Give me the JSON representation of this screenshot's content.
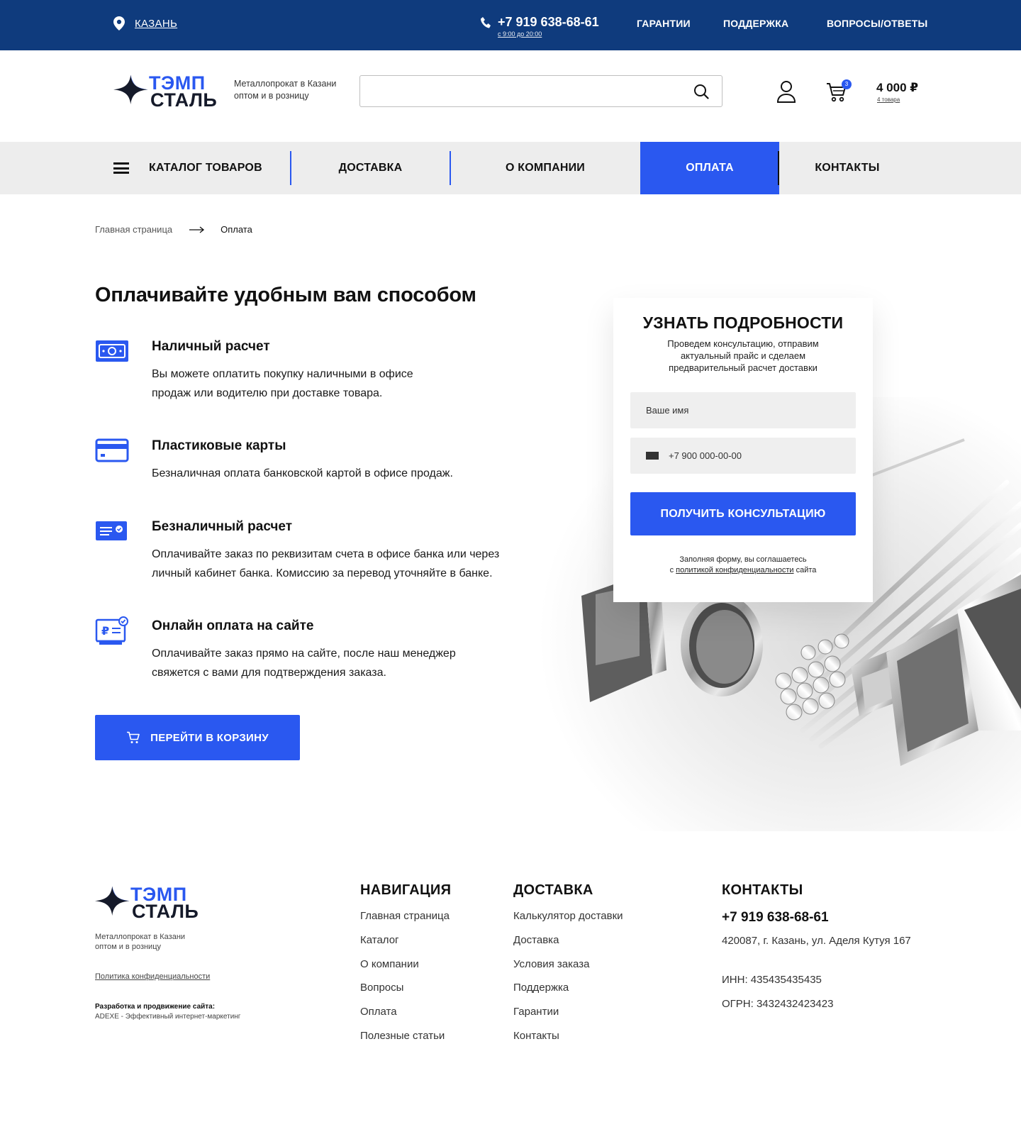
{
  "topbar": {
    "city": "КАЗАНЬ",
    "phone": "+7 919 638-68-61",
    "hours": "с 9:00 до 20:00",
    "links": [
      "ГАРАНТИИ",
      "ПОДДЕРЖКА",
      "ВОПРОСЫ/ОТВЕТЫ"
    ]
  },
  "brand": {
    "logo_line1": "ТЭМП",
    "logo_line2": "СТАЛЬ",
    "tagline_line1": "Металлопрокат в Казани",
    "tagline_line2": "оптом и в розницу"
  },
  "header": {
    "search_placeholder": "",
    "cart_badge": "3",
    "cart_sum": "4 000 ₽",
    "cart_count": "4 товара"
  },
  "nav": {
    "items": [
      "КАТАЛОГ ТОВАРОВ",
      "ДОСТАВКА",
      "О КОМПАНИИ",
      "ОПЛАТА",
      "КОНТАКТЫ"
    ],
    "active": "ОПЛАТА"
  },
  "breadcrumb": {
    "home": "Главная страница",
    "current": "Оплата"
  },
  "main": {
    "title": "Оплачивайте удобным вам способом",
    "methods": [
      {
        "icon": "cash-icon",
        "title": "Наличный расчет",
        "desc": "Вы можете оплатить покупку наличными в офисе продаж или водителю при доставке товара."
      },
      {
        "icon": "card-icon",
        "title": "Пластиковые карты",
        "desc": "Безналичная оплата банковской картой в офисе продаж."
      },
      {
        "icon": "bank-transfer-icon",
        "title": "Безналичный расчет",
        "desc": "Оплачивайте заказ по реквизитам счета в офисе банка или через личный кабинет банка. Комиссию за перевод уточняйте в банке."
      },
      {
        "icon": "online-payment-icon",
        "title": "Онлайн оплата на сайте",
        "desc": "Оплачивайте заказ прямо на сайте, после наш менеджер свяжется с вами для подтверждения заказа."
      }
    ],
    "cart_button": "ПЕРЕЙТИ В КОРЗИНУ"
  },
  "form": {
    "title": "УЗНАТЬ ПОДРОБНОСТИ",
    "subtitle": "Проведем консультацию, отправим актуальный прайс и сделаем предварительный расчет доставки",
    "name_placeholder": "Ваше имя",
    "phone_placeholder": "+7 900 000-00-00",
    "submit": "ПОЛУЧИТЬ КОНСУЛЬТАЦИЮ",
    "note_line1": "Заполняя форму, вы соглашаетесь",
    "note_prefix": "с",
    "note_link": "политикой конфиденциальности",
    "note_suffix": "сайта"
  },
  "footer": {
    "policy": "Политика конфиденциальности",
    "dev_title": "Разработка и продвижение сайта:",
    "dev": "ADEXE - Эффективный интернет-маркетинг",
    "nav_title": "НАВИГАЦИЯ",
    "nav_links": [
      "Главная страница",
      "Каталог",
      "О компании",
      "Вопросы",
      "Оплата",
      "Полезные статьи"
    ],
    "delivery_title": "ДОСТАВКА",
    "delivery_links": [
      "Калькулятор доставки",
      "Доставка",
      "Условия заказа",
      "Поддержка",
      "Гарантии",
      "Контакты"
    ],
    "contacts_title": "КОНТАКТЫ",
    "phone": "+7 919 638-68-61",
    "address": "420087,  г. Казань, ул. Аделя Кутуя 167",
    "inn": "ИНН: 435435435435",
    "ogrn": "ОГРН: 3432432423423"
  },
  "colors": {
    "topbar": "#0f3b7d",
    "accent": "#2a58f0",
    "nav_bg": "#ededed",
    "field_bg": "#efefef"
  }
}
